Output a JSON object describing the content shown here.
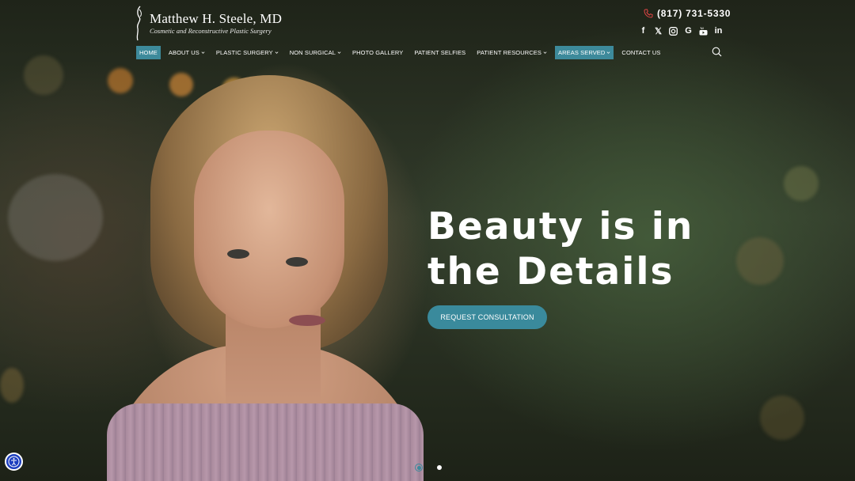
{
  "brand": {
    "name": "Matthew H. Steele, MD",
    "tagline": "Cosmetic and Reconstructive Plastic Surgery"
  },
  "header": {
    "phone": "(817) 731-5330",
    "socials": [
      "facebook-icon",
      "x-icon",
      "instagram-icon",
      "google-icon",
      "youtube-icon",
      "linkedin-icon"
    ]
  },
  "nav": {
    "items": [
      {
        "label": "HOME",
        "active": true,
        "dropdown": false
      },
      {
        "label": "ABOUT US",
        "active": false,
        "dropdown": true
      },
      {
        "label": "PLASTIC SURGERY",
        "active": false,
        "dropdown": true
      },
      {
        "label": "NON SURGICAL",
        "active": false,
        "dropdown": true
      },
      {
        "label": "PHOTO GALLERY",
        "active": false,
        "dropdown": false
      },
      {
        "label": "PATIENT SELFIES",
        "active": false,
        "dropdown": false
      },
      {
        "label": "PATIENT RESOURCES",
        "active": false,
        "dropdown": true
      },
      {
        "label": "AREAS SERVED",
        "active": true,
        "dropdown": true
      },
      {
        "label": "CONTACT US",
        "active": false,
        "dropdown": false
      }
    ]
  },
  "hero": {
    "headline_line1": "Beauty is in",
    "headline_line2": "the Details",
    "cta_label": "REQUEST CONSULTATION"
  },
  "slider": {
    "count": 2,
    "current": 1
  },
  "colors": {
    "accent": "#3a8a9c",
    "accessibility": "#1d3fbf"
  }
}
